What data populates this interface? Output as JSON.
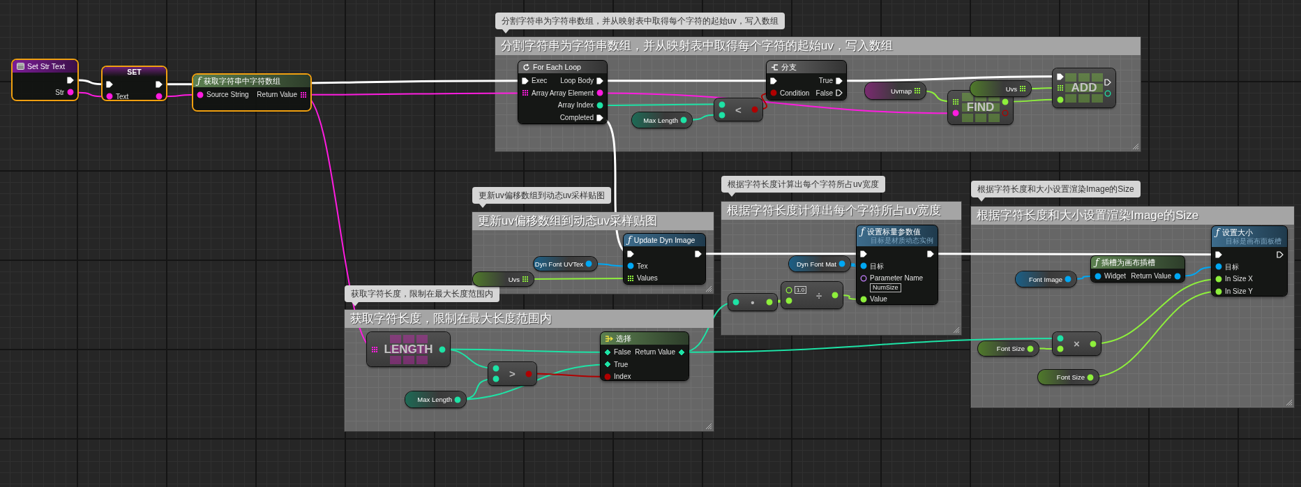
{
  "comments": [
    {
      "bubble": "分割字符串为字符串数组，并从映射表中取得每个字符的起始uv，写入数组",
      "title": "分割字符串为字符串数组，并从映射表中取得每个字符的起始uv，写入数组"
    },
    {
      "bubble": "更新uv偏移数组到动态uv采样贴图",
      "title": "更新uv偏移数组到动态uv采样贴图"
    },
    {
      "bubble": "根据字符长度计算出每个字符所占uv宽度",
      "title": "根据字符长度计算出每个字符所占uv宽度"
    },
    {
      "bubble": "获取字符长度，限制在最大长度范围内",
      "title": "获取字符长度，限制在最大长度范围内"
    },
    {
      "bubble": "根据字符长度和大小设置渲染Image的Size",
      "title": "根据字符长度和大小设置渲染Image的Size"
    }
  ],
  "nodes": [
    {
      "kind": "event",
      "title": "Set Str Text",
      "selected": true,
      "outputs": [
        {
          "kind": "exec",
          "connected": true
        },
        {
          "kind": "string",
          "label": "Str",
          "connected": true
        }
      ]
    },
    {
      "kind": "set",
      "title": "SET",
      "selected": true,
      "inputs": [
        {
          "kind": "exec",
          "connected": true
        },
        {
          "kind": "string",
          "label": "Text",
          "connected": true
        }
      ],
      "outputs": [
        {
          "kind": "exec",
          "connected": true
        },
        {
          "kind": "string",
          "connected": true
        }
      ]
    },
    {
      "kind": "pure",
      "icon": "ƒ",
      "title": "获取字符串中字符数组",
      "selected": true,
      "inputs": [
        {
          "kind": "string",
          "label": "Source String",
          "connected": true
        }
      ],
      "outputs": [
        {
          "kind": "string-array",
          "label": "Return Value",
          "connected": true
        }
      ]
    },
    {
      "kind": "macro",
      "title": "For Each Loop",
      "selected": false,
      "inputs": [
        {
          "kind": "exec",
          "label": "Exec",
          "connected": true
        },
        {
          "kind": "string-array",
          "label": "Array",
          "connected": true
        }
      ],
      "outputs": [
        {
          "kind": "exec",
          "label": "Loop Body",
          "connected": true
        },
        {
          "kind": "string",
          "label": "Array Element",
          "connected": true
        },
        {
          "kind": "int",
          "label": "Array Index",
          "connected": true
        },
        {
          "kind": "exec",
          "label": "Completed",
          "connected": true
        }
      ]
    },
    {
      "kind": "variable",
      "title": "Max Length",
      "selected": false,
      "outputs": [
        {
          "kind": "int",
          "connected": true
        }
      ]
    },
    {
      "kind": "compact",
      "title": "<",
      "selected": false,
      "inputs": [
        {
          "kind": "int",
          "connected": true
        },
        {
          "kind": "int",
          "connected": true
        }
      ],
      "outputs": [
        {
          "kind": "bool",
          "connected": true
        }
      ]
    },
    {
      "kind": "branch",
      "title": "分支",
      "selected": false,
      "inputs": [
        {
          "kind": "exec",
          "connected": true
        },
        {
          "kind": "bool",
          "label": "Condition",
          "connected": true
        }
      ],
      "outputs": [
        {
          "kind": "exec",
          "label": "True",
          "connected": true
        },
        {
          "kind": "exec",
          "label": "False",
          "connected": false
        }
      ]
    },
    {
      "kind": "variable",
      "title": "Uvmap",
      "selected": false,
      "outputs": [
        {
          "kind": "map",
          "connected": true
        }
      ]
    },
    {
      "kind": "array-op",
      "title": "FIND",
      "selected": false,
      "inputs": [
        {
          "kind": "map",
          "connected": true
        },
        {
          "kind": "string",
          "connected": true
        }
      ],
      "outputs": [
        {
          "kind": "float",
          "connected": true
        },
        {
          "kind": "bool",
          "connected": false
        }
      ]
    },
    {
      "kind": "variable",
      "title": "Uvs",
      "selected": false,
      "outputs": [
        {
          "kind": "float-array",
          "connected": true
        }
      ]
    },
    {
      "kind": "array-op",
      "title": "ADD",
      "selected": false,
      "inputs": [
        {
          "kind": "exec",
          "connected": true
        },
        {
          "kind": "float-array",
          "connected": true
        },
        {
          "kind": "float",
          "connected": true
        }
      ],
      "outputs": [
        {
          "kind": "exec",
          "connected": false
        },
        {
          "kind": "int",
          "connected": false
        }
      ]
    },
    {
      "kind": "variable",
      "title": "Uvs",
      "selected": false,
      "outputs": [
        {
          "kind": "float-array",
          "connected": true
        }
      ]
    },
    {
      "kind": "variable",
      "title": "Dyn Font UVTex",
      "selected": false,
      "outputs": [
        {
          "kind": "object",
          "connected": true
        }
      ]
    },
    {
      "kind": "function",
      "icon": "ƒ",
      "title": "Update Dyn Image",
      "selected": false,
      "inputs": [
        {
          "kind": "exec",
          "connected": true
        },
        {
          "kind": "object",
          "label": "Tex",
          "connected": true
        },
        {
          "kind": "float-array",
          "label": "Values",
          "connected": true
        }
      ],
      "outputs": [
        {
          "kind": "exec",
          "connected": true
        }
      ]
    },
    {
      "kind": "variable",
      "title": "Dyn Font Mat",
      "selected": false,
      "outputs": [
        {
          "kind": "object",
          "connected": true
        }
      ]
    },
    {
      "kind": "compact",
      "title": "•",
      "selected": false,
      "inputs": [
        {
          "kind": "int",
          "connected": true
        }
      ],
      "outputs": [
        {
          "kind": "float",
          "connected": true
        }
      ]
    },
    {
      "kind": "compact",
      "title": "÷",
      "selected": false,
      "inputs": [
        {
          "kind": "float",
          "value": "1.0",
          "connected": false
        },
        {
          "kind": "float",
          "connected": true
        }
      ],
      "outputs": [
        {
          "kind": "float",
          "connected": true
        }
      ]
    },
    {
      "kind": "function",
      "icon": "ƒ",
      "title": "设置标量参数值",
      "subtitle": "目标是材质动态实例",
      "selected": false,
      "inputs": [
        {
          "kind": "exec",
          "connected": true
        },
        {
          "kind": "object",
          "label": "目标",
          "connected": true
        },
        {
          "kind": "name",
          "label": "Parameter Name",
          "value": "NumSize",
          "connected": false
        },
        {
          "kind": "float",
          "label": "Value",
          "connected": true
        }
      ],
      "outputs": [
        {
          "kind": "exec",
          "connected": true
        }
      ]
    },
    {
      "kind": "variable",
      "title": "Font Image",
      "selected": false,
      "outputs": [
        {
          "kind": "object",
          "connected": true
        }
      ]
    },
    {
      "kind": "pure",
      "icon": "ƒ",
      "title": "插槽为画布插槽",
      "selected": false,
      "inputs": [
        {
          "kind": "object",
          "label": "Widget",
          "connected": true
        }
      ],
      "outputs": [
        {
          "kind": "object",
          "label": "Return Value",
          "connected": true
        }
      ]
    },
    {
      "kind": "function",
      "icon": "ƒ",
      "title": "设置大小",
      "subtitle": "目标是画布面板槽",
      "selected": false,
      "inputs": [
        {
          "kind": "exec",
          "connected": true
        },
        {
          "kind": "object",
          "label": "目标",
          "connected": true
        },
        {
          "kind": "float",
          "label": "In Size X",
          "connected": true
        },
        {
          "kind": "float",
          "label": "In Size Y",
          "connected": true
        }
      ],
      "outputs": [
        {
          "kind": "exec",
          "connected": false
        }
      ]
    },
    {
      "kind": "array-op",
      "title": "LENGTH",
      "selected": false,
      "inputs": [
        {
          "kind": "string-array",
          "connected": true
        }
      ],
      "outputs": [
        {
          "kind": "int",
          "connected": true
        }
      ]
    },
    {
      "kind": "variable",
      "title": "Max Length",
      "selected": false,
      "outputs": [
        {
          "kind": "int",
          "connected": true
        }
      ]
    },
    {
      "kind": "compact",
      "title": ">",
      "selected": false,
      "inputs": [
        {
          "kind": "int",
          "connected": true
        },
        {
          "kind": "int",
          "connected": true
        }
      ],
      "outputs": [
        {
          "kind": "bool",
          "connected": true
        }
      ]
    },
    {
      "kind": "select",
      "title": "选择",
      "selected": false,
      "inputs": [
        {
          "kind": "wildcard",
          "label": "False",
          "connected": true
        },
        {
          "kind": "wildcard",
          "label": "True",
          "connected": true
        },
        {
          "kind": "bool",
          "label": "Index",
          "connected": true
        }
      ],
      "outputs": [
        {
          "kind": "wildcard",
          "label": "Return Value",
          "connected": true
        }
      ]
    },
    {
      "kind": "variable",
      "title": "Font Size",
      "selected": false,
      "outputs": [
        {
          "kind": "float",
          "connected": true
        }
      ]
    },
    {
      "kind": "compact",
      "title": "×",
      "selected": false,
      "inputs": [
        {
          "kind": "int",
          "connected": true
        },
        {
          "kind": "float",
          "connected": true
        }
      ],
      "outputs": [
        {
          "kind": "float",
          "connected": true
        }
      ]
    },
    {
      "kind": "variable",
      "title": "Font Size",
      "selected": false,
      "outputs": [
        {
          "kind": "float",
          "connected": true
        }
      ]
    }
  ]
}
